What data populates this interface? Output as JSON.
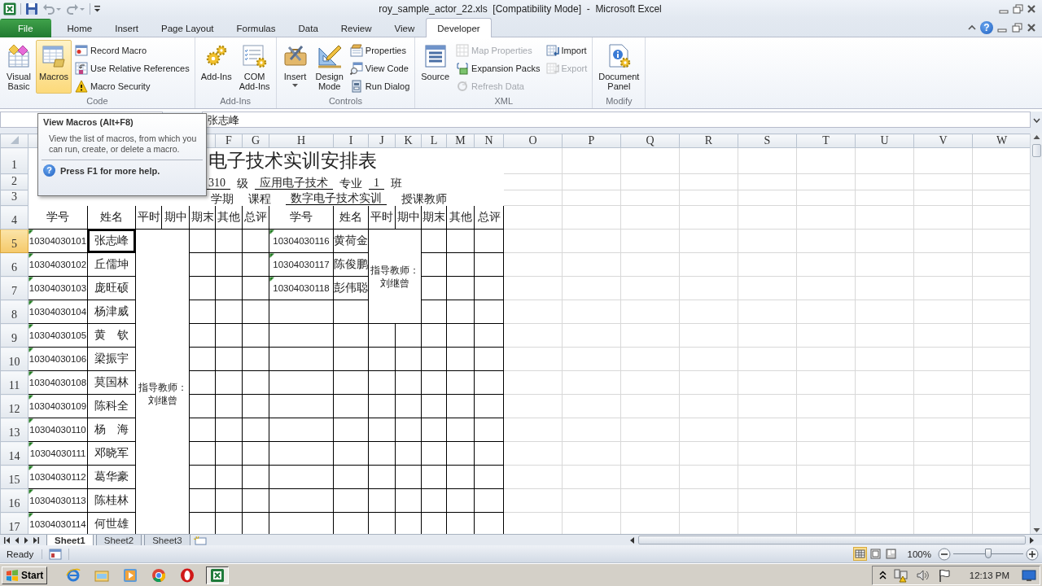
{
  "title_bar": {
    "title": "roy_sample_actor_22.xls  [Compatibility Mode]  -  Microsoft Excel"
  },
  "ribbon_tabs": [
    {
      "label": "File",
      "kind": "file",
      "selected": false
    },
    {
      "label": "Home",
      "kind": "tab",
      "selected": false
    },
    {
      "label": "Insert",
      "kind": "tab",
      "selected": false
    },
    {
      "label": "Page Layout",
      "kind": "tab",
      "selected": false
    },
    {
      "label": "Formulas",
      "kind": "tab",
      "selected": false
    },
    {
      "label": "Data",
      "kind": "tab",
      "selected": false
    },
    {
      "label": "Review",
      "kind": "tab",
      "selected": false
    },
    {
      "label": "View",
      "kind": "tab",
      "selected": false
    },
    {
      "label": "Developer",
      "kind": "tab",
      "selected": true
    }
  ],
  "help_glyph": "?",
  "ribbon_groups": [
    {
      "label": "Code",
      "items": [
        {
          "kind": "large",
          "label": "Visual\nBasic",
          "dropdown": false,
          "highlighted": false
        },
        {
          "kind": "large",
          "label": "Macros",
          "dropdown": false,
          "highlighted": true
        },
        {
          "kind": "stack",
          "buttons": [
            {
              "label": "Record Macro",
              "disabled": false
            },
            {
              "label": "Use Relative References",
              "disabled": false
            },
            {
              "label": "Macro Security",
              "disabled": false
            }
          ]
        }
      ]
    },
    {
      "label": "Add-Ins",
      "items": [
        {
          "kind": "large",
          "label": "Add-Ins",
          "dropdown": false,
          "highlighted": false
        },
        {
          "kind": "large",
          "label": "COM\nAdd-Ins",
          "dropdown": false,
          "highlighted": false
        }
      ]
    },
    {
      "label": "Controls",
      "items": [
        {
          "kind": "large",
          "label": "Insert",
          "dropdown": true,
          "highlighted": false
        },
        {
          "kind": "large",
          "label": "Design\nMode",
          "dropdown": false,
          "highlighted": false
        },
        {
          "kind": "stack",
          "buttons": [
            {
              "label": "Properties",
              "disabled": false
            },
            {
              "label": "View Code",
              "disabled": false
            },
            {
              "label": "Run Dialog",
              "disabled": false
            }
          ]
        }
      ]
    },
    {
      "label": "XML",
      "items": [
        {
          "kind": "large",
          "label": "Source",
          "dropdown": false,
          "highlighted": false
        },
        {
          "kind": "stack",
          "buttons": [
            {
              "label": "Map Properties",
              "disabled": true
            },
            {
              "label": "Expansion Packs",
              "disabled": false
            },
            {
              "label": "Refresh Data",
              "disabled": true
            }
          ]
        },
        {
          "kind": "stack",
          "buttons": [
            {
              "label": "Import",
              "disabled": false
            },
            {
              "label": "Export",
              "disabled": true
            }
          ]
        }
      ]
    },
    {
      "label": "Modify",
      "items": [
        {
          "kind": "large",
          "label": "Document\nPanel",
          "dropdown": false,
          "highlighted": false
        }
      ]
    }
  ],
  "formula_bar": {
    "value": "张志峰"
  },
  "tooltip": {
    "title": "View Macros (Alt+F8)",
    "body": "View the list of macros, from which you can run, create, or delete a macro.",
    "help": "Press F1 for more help."
  },
  "sheet": {
    "column_headers": [
      "F",
      "G",
      "H",
      "I",
      "J",
      "K",
      "L",
      "M",
      "N",
      "O",
      "P",
      "Q",
      "R",
      "S",
      "T",
      "U",
      "V",
      "W"
    ],
    "row_headers": [
      "1",
      "2",
      "3",
      "4",
      "5",
      "6",
      "7",
      "8",
      "9",
      "10",
      "11",
      "12",
      "13",
      "14",
      "15",
      "16",
      "17"
    ],
    "title": "电子技术实训安排表",
    "class_line": [
      {
        "text": "310",
        "underline": true
      },
      {
        "text": "级",
        "underline": false
      },
      {
        "text": "应用电子技术",
        "underline": true
      },
      {
        "text": "专业",
        "underline": false
      },
      {
        "text": "1",
        "underline": true
      },
      {
        "text": "班",
        "underline": false
      }
    ],
    "course_line": [
      {
        "text": "学期",
        "underline": false
      },
      {
        "text": "课程",
        "underline": false
      },
      {
        "text": "数字电子技术实训",
        "underline": true
      },
      {
        "text": "授课教师",
        "underline": false
      }
    ],
    "table_header": [
      "学号",
      "姓名",
      "平时",
      "期中",
      "期末",
      "其他",
      "总评",
      "学号",
      "姓名",
      "平时",
      "期中",
      "期末",
      "其他",
      "总评"
    ],
    "left_students": [
      {
        "id": "10304030101",
        "name": "张志峰",
        "selected": true
      },
      {
        "id": "10304030102",
        "name": "丘儒坤",
        "selected": false
      },
      {
        "id": "10304030103",
        "name": "庞旺硕",
        "selected": false
      },
      {
        "id": "10304030104",
        "name": "杨津威",
        "selected": false
      },
      {
        "id": "10304030105",
        "name": "黄　钦",
        "selected": false
      },
      {
        "id": "10304030106",
        "name": "梁振宇",
        "selected": false
      },
      {
        "id": "10304030108",
        "name": "莫国林",
        "selected": false
      },
      {
        "id": "10304030109",
        "name": "陈科全",
        "selected": false
      },
      {
        "id": "10304030110",
        "name": "杨　海",
        "selected": false
      },
      {
        "id": "10304030111",
        "name": "邓晓军",
        "selected": false
      },
      {
        "id": "10304030112",
        "name": "葛华豪",
        "selected": false
      },
      {
        "id": "10304030113",
        "name": "陈桂林",
        "selected": false
      },
      {
        "id": "10304030114",
        "name": "何世雄",
        "selected": false
      }
    ],
    "left_advisor": [
      "指导教师：",
      "刘继曾"
    ],
    "right_students": [
      {
        "id": "10304030116",
        "name": "黄荷金"
      },
      {
        "id": "10304030117",
        "name": "陈俊鹏"
      },
      {
        "id": "10304030118",
        "name": "彭伟聪"
      }
    ],
    "right_advisor": [
      "指导教师：",
      "刘继曾"
    ]
  },
  "sheet_tabs": [
    {
      "label": "Sheet1",
      "selected": true
    },
    {
      "label": "Sheet2",
      "selected": false
    },
    {
      "label": "Sheet3",
      "selected": false
    }
  ],
  "status_bar": {
    "text": "Ready",
    "view_buttons": [
      {
        "selected": true
      },
      {
        "selected": false
      },
      {
        "selected": false
      }
    ],
    "zoom": "100%",
    "zoom_slider": {
      "level": 0.5
    }
  },
  "taskbar": {
    "start": "Start",
    "apps": [
      {
        "selected": false
      },
      {
        "selected": false
      },
      {
        "selected": false
      },
      {
        "selected": false
      },
      {
        "selected": false
      },
      {
        "selected": true
      }
    ],
    "time": "12:13 PM"
  }
}
